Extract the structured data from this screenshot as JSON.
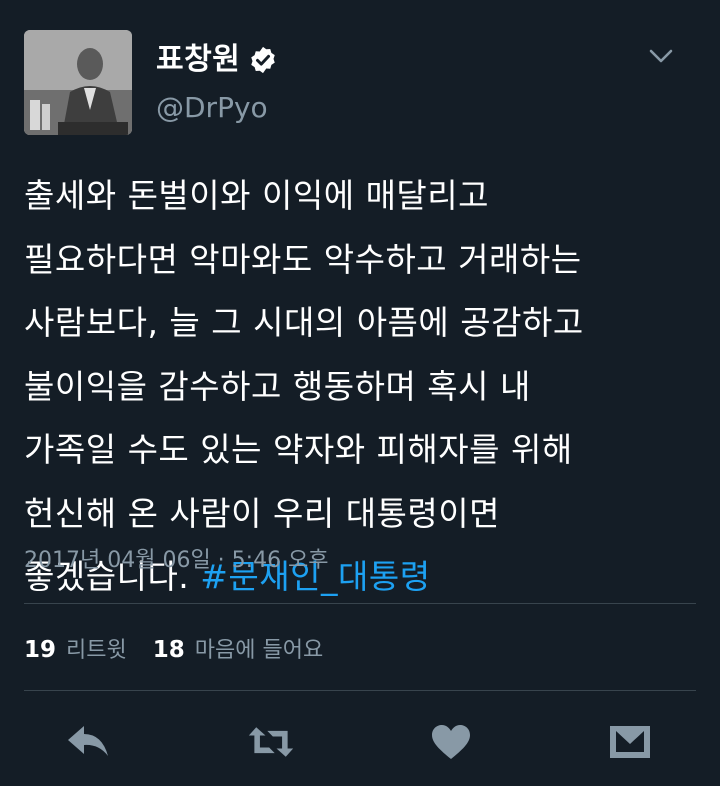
{
  "user": {
    "display_name": "표창원",
    "handle": "@DrPyo",
    "verified": true
  },
  "tweet": {
    "text": "출세와 돈벌이와 이익에 매달리고\n필요하다면 악마와도 악수하고 거래하는\n사람보다, 늘 그 시대의 아픔에 공감하고\n불이익을 감수하고 행동하며 혹시 내\n가족일 수도 있는 약자와 피해자를 위해\n헌신해 온 사람이 우리 대통령이면\n좋겠습니다. ",
    "hashtag": "#문재인_대통령",
    "timestamp": "2017년 04월 06일 · 5:46 오후"
  },
  "stats": {
    "retweets_count": "19",
    "retweets_label": "리트윗",
    "likes_count": "18",
    "likes_label": "마음에 들어요"
  },
  "icons": {
    "verified": "verified-badge-icon",
    "menu": "chevron-down-icon",
    "reply": "reply-icon",
    "retweet": "retweet-icon",
    "like": "heart-icon",
    "dm": "direct-message-icon"
  },
  "colors": {
    "background": "#141d26",
    "secondary_text": "#8899a6",
    "hashtag": "#1da1f2",
    "divider": "#38444d"
  }
}
